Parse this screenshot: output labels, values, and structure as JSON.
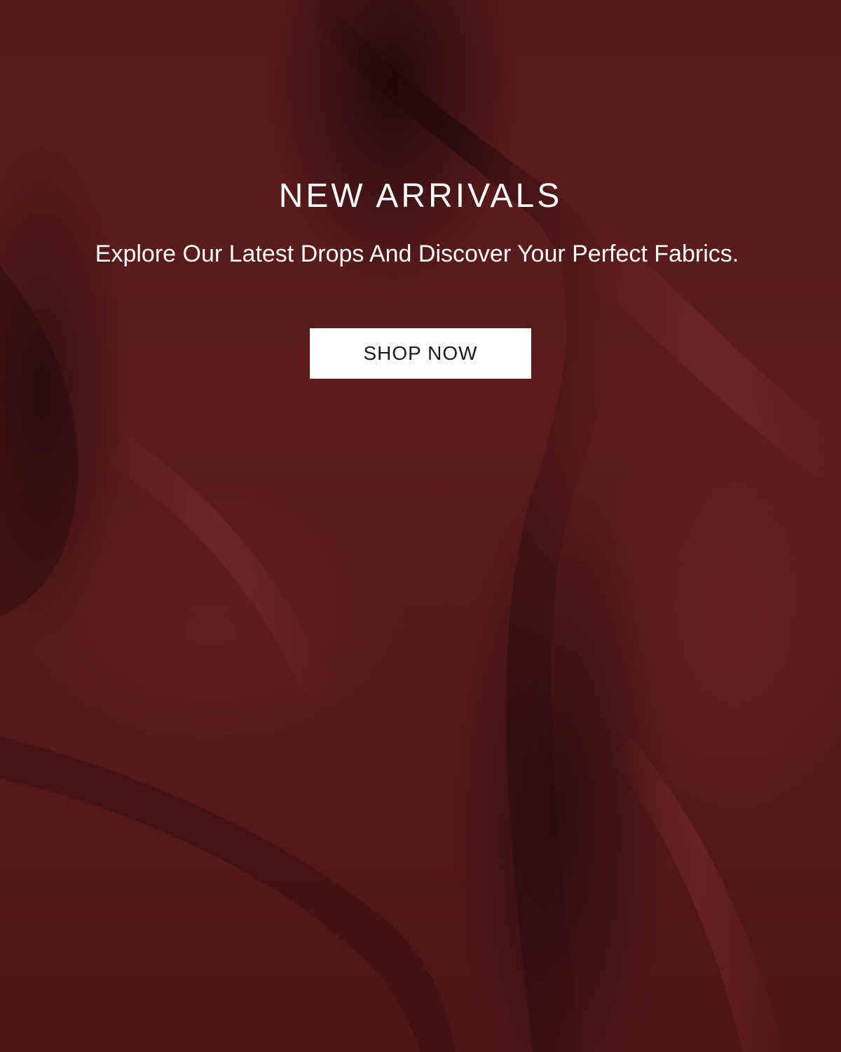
{
  "hero": {
    "title": "NEW ARRIVALS",
    "subtitle": "Explore Our Latest Drops And Discover Your Perfect Fabrics.",
    "cta_label": "SHOP NOW",
    "background_color": "#5a1c1f",
    "background_image": "burgundy-satin-fabric"
  }
}
